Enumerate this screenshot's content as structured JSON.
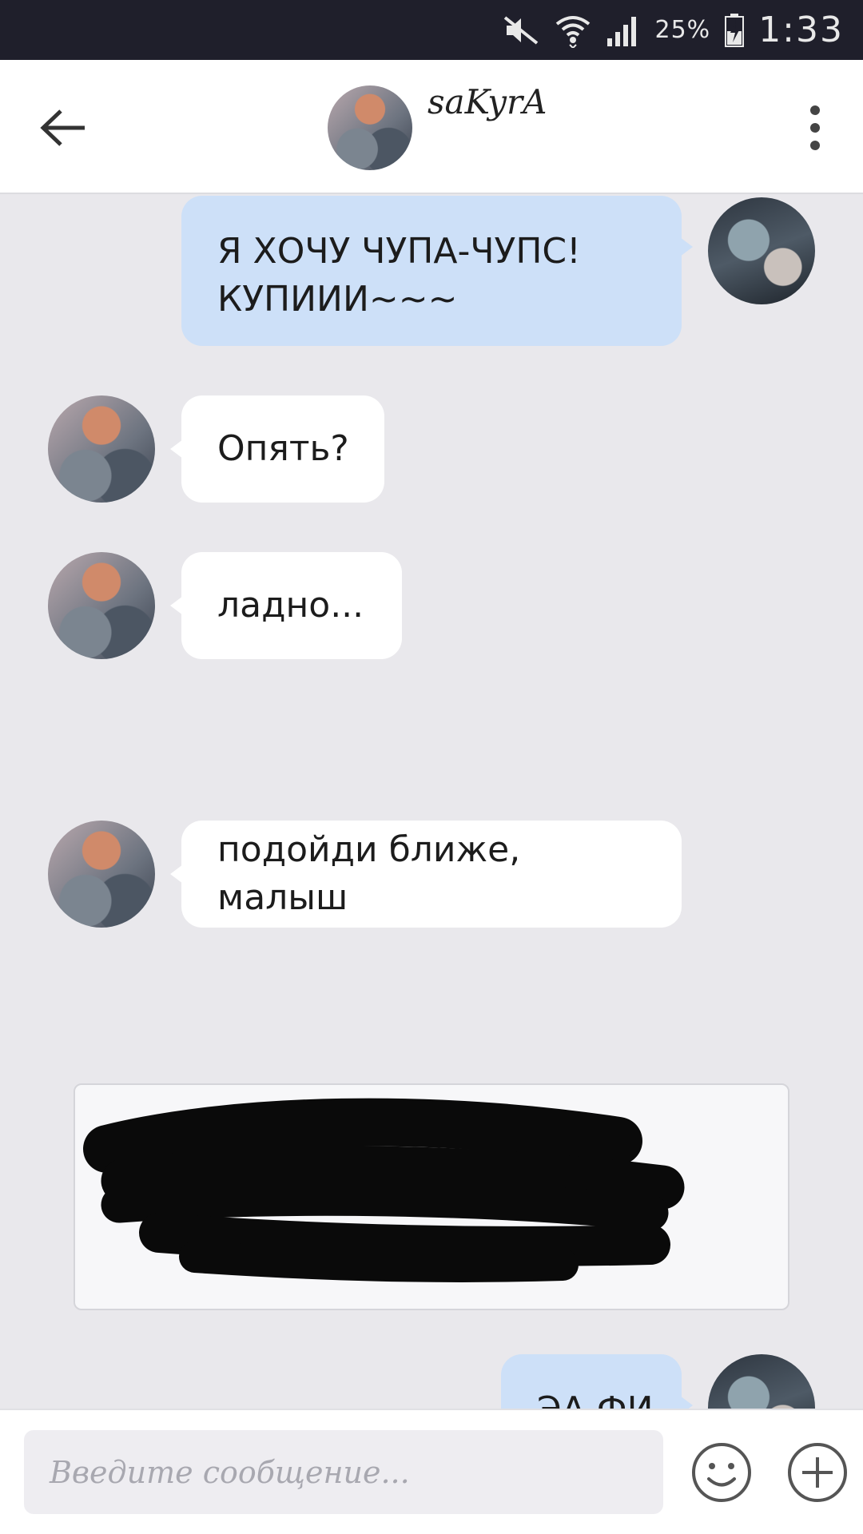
{
  "status_bar": {
    "battery_text": "25%",
    "time": "1:33",
    "icons": [
      "muted-speaker-icon",
      "wifi-icon",
      "cell-signal-icon",
      "battery-charging-icon"
    ]
  },
  "header": {
    "contact_name": "saKyrA",
    "back_icon": "back-arrow-icon",
    "menu_icon": "overflow-menu-icon"
  },
  "messages": [
    {
      "direction": "outgoing",
      "lines": [
        "Я ХОЧУ ЧУПА-ЧУПС!",
        "КУПИИИ~~~"
      ]
    },
    {
      "direction": "incoming",
      "text": "Опять?"
    },
    {
      "direction": "incoming",
      "text": "ладно..."
    },
    {
      "direction": "incoming",
      "text": "подойди ближе, малыш"
    },
    {
      "direction": "incoming",
      "type": "image",
      "content": "scribbled-out image"
    },
    {
      "direction": "outgoing",
      "text": "ЭА ФИ"
    }
  ],
  "input": {
    "placeholder": "Введите сообщение...",
    "emoji_icon": "smiley-icon",
    "add_icon": "plus-circle-icon"
  },
  "colors": {
    "status_bar_bg": "#1f1f2b",
    "chat_bg": "#e9e8ec",
    "outgoing_bubble": "#cde0f8",
    "incoming_bubble": "#ffffff"
  }
}
